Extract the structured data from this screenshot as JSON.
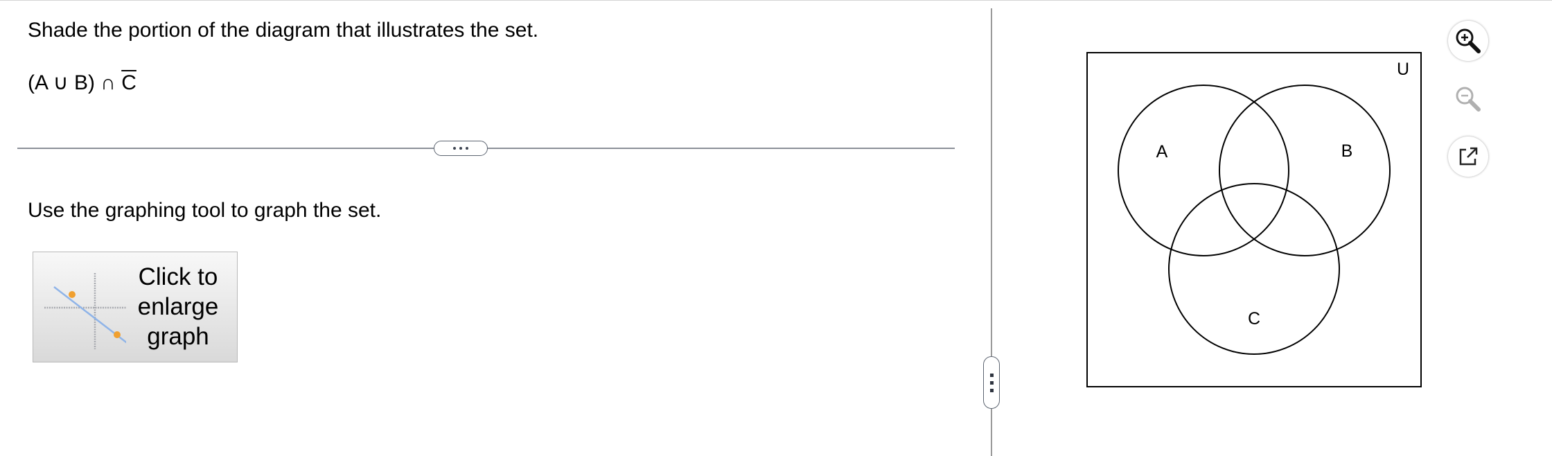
{
  "question": {
    "prompt": "Shade the portion of the diagram that illustrates the set.",
    "set_expression": {
      "left_part": "(A ∪ B) ∩ ",
      "complement_letter": "C"
    }
  },
  "instruction": "Use the graphing tool to graph the set.",
  "graph_button": {
    "label_line1": "Click to",
    "label_line2": "enlarge",
    "label_line3": "graph"
  },
  "venn": {
    "universe_label": "U",
    "set_labels": {
      "a": "A",
      "b": "B",
      "c": "C"
    }
  },
  "toolbar": {
    "icons": [
      "zoom-in-icon",
      "zoom-out-icon",
      "popout-icon"
    ]
  },
  "colors": {
    "divider": "#8a8f98",
    "graph_line": "#8fb4e8",
    "graph_point": "#f0a030"
  }
}
